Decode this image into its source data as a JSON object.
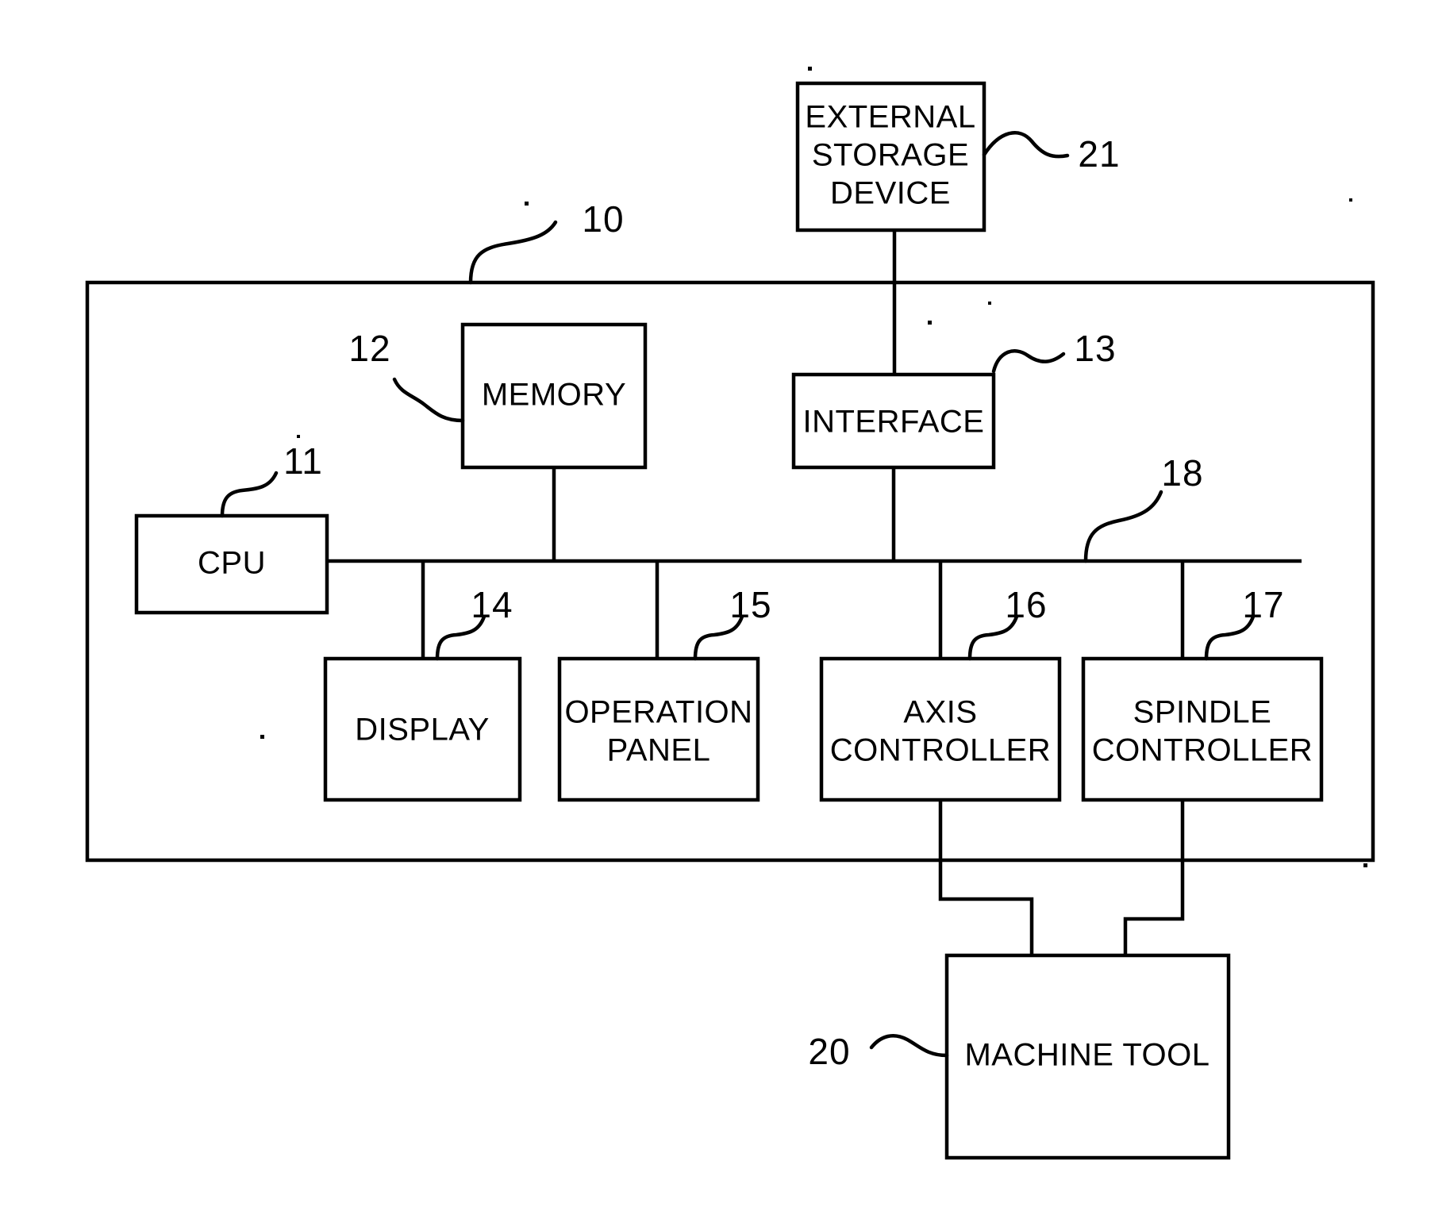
{
  "figure": {
    "kind": "patent-block-diagram",
    "subject": "numerical controller connected to a machine tool",
    "line_color": "#000000",
    "background_color": "#ffffff"
  },
  "blocks": {
    "external_storage_device": {
      "label_lines": [
        "EXTERNAL",
        "STORAGE",
        "DEVICE"
      ],
      "ref": "21"
    },
    "controller_enclosure": {
      "label": "",
      "ref": "10"
    },
    "memory": {
      "label_lines": [
        "MEMORY"
      ],
      "ref": "12"
    },
    "interface": {
      "label_lines": [
        "INTERFACE"
      ],
      "ref": "13"
    },
    "cpu": {
      "label_lines": [
        "CPU"
      ],
      "ref": "11"
    },
    "bus": {
      "label": "",
      "ref": "18"
    },
    "display": {
      "label_lines": [
        "DISPLAY"
      ],
      "ref": "14"
    },
    "operation_panel": {
      "label_lines": [
        "OPERATION",
        "PANEL"
      ],
      "ref": "15"
    },
    "axis_controller": {
      "label_lines": [
        "AXIS",
        "CONTROLLER"
      ],
      "ref": "16"
    },
    "spindle_controller": {
      "label_lines": [
        "SPINDLE",
        "CONTROLLER"
      ],
      "ref": "17"
    },
    "machine_tool": {
      "label_lines": [
        "MACHINE TOOL"
      ],
      "ref": "20"
    }
  },
  "reference_numerals": [
    {
      "id": "10",
      "target": "controller-enclosure"
    },
    {
      "id": "11",
      "target": "cpu"
    },
    {
      "id": "12",
      "target": "memory"
    },
    {
      "id": "13",
      "target": "interface"
    },
    {
      "id": "14",
      "target": "display"
    },
    {
      "id": "15",
      "target": "operation-panel"
    },
    {
      "id": "16",
      "target": "axis-controller"
    },
    {
      "id": "17",
      "target": "spindle-controller"
    },
    {
      "id": "18",
      "target": "bus"
    },
    {
      "id": "20",
      "target": "machine-tool"
    },
    {
      "id": "21",
      "target": "external-storage-device"
    }
  ]
}
